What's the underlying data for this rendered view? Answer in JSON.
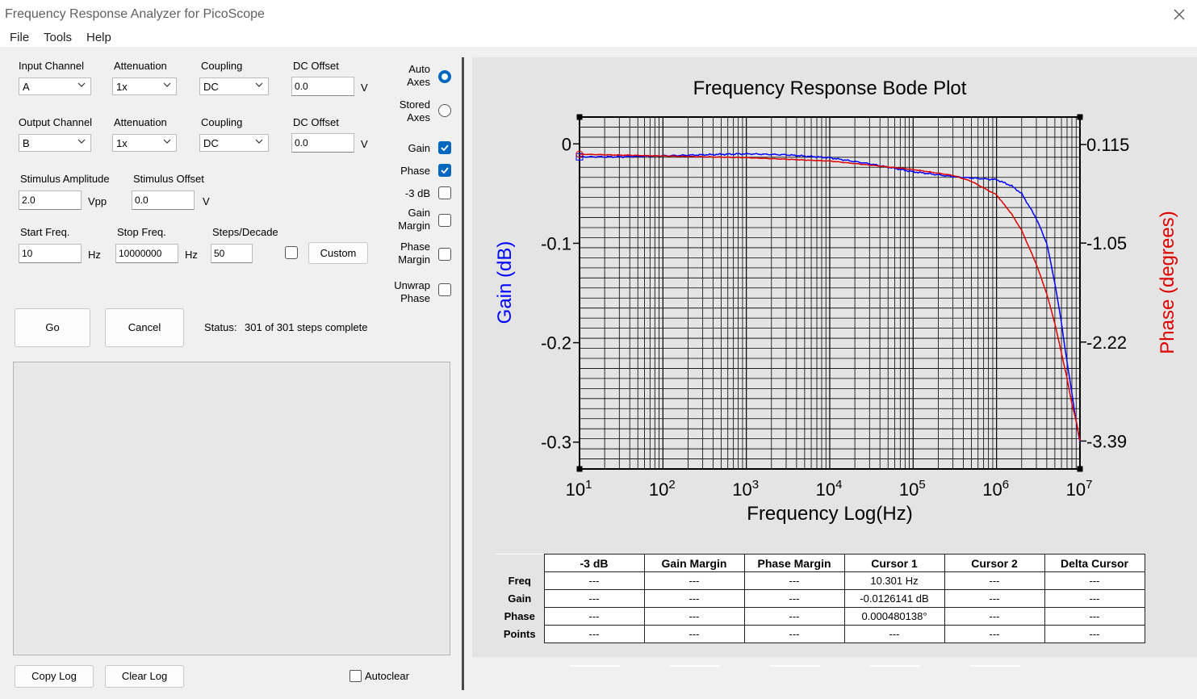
{
  "window": {
    "title": "Frequency Response Analyzer for PicoScope"
  },
  "menu": [
    "File",
    "Tools",
    "Help"
  ],
  "input_channel": {
    "label": "Input Channel",
    "value": "A"
  },
  "input_attenuation": {
    "label": "Attenuation",
    "value": "1x"
  },
  "input_coupling": {
    "label": "Coupling",
    "value": "DC"
  },
  "input_dc_offset": {
    "label": "DC Offset",
    "value": "0.0",
    "unit": "V"
  },
  "output_channel": {
    "label": "Output Channel",
    "value": "B"
  },
  "output_attenuation": {
    "label": "Attenuation",
    "value": "1x"
  },
  "output_coupling": {
    "label": "Coupling",
    "value": "DC"
  },
  "output_dc_offset": {
    "label": "DC Offset",
    "value": "0.0",
    "unit": "V"
  },
  "stimulus_amplitude": {
    "label": "Stimulus Amplitude",
    "value": "2.0",
    "unit": "Vpp"
  },
  "stimulus_offset": {
    "label": "Stimulus Offset",
    "value": "0.0",
    "unit": "V"
  },
  "start_freq": {
    "label": "Start Freq.",
    "value": "10",
    "unit": "Hz"
  },
  "stop_freq": {
    "label": "Stop Freq.",
    "value": "10000000",
    "unit": "Hz"
  },
  "steps_decade": {
    "label": "Steps/Decade",
    "value": "50"
  },
  "custom_button": "Custom",
  "go_button": "Go",
  "cancel_button": "Cancel",
  "status": {
    "label": "Status:",
    "value": "301 of 301 steps complete"
  },
  "options": {
    "auto_axes": {
      "label1": "Auto",
      "label2": "Axes",
      "selected": true
    },
    "stored_axes": {
      "label1": "Stored",
      "label2": "Axes",
      "selected": false
    },
    "gain": {
      "label": "Gain",
      "checked": true
    },
    "phase": {
      "label": "Phase",
      "checked": true
    },
    "minus3db": {
      "label": "-3 dB",
      "checked": false
    },
    "gain_margin": {
      "label1": "Gain",
      "label2": "Margin",
      "checked": false
    },
    "phase_margin": {
      "label1": "Phase",
      "label2": "Margin",
      "checked": false
    },
    "unwrap_phase": {
      "label1": "Unwrap",
      "label2": "Phase",
      "checked": false
    }
  },
  "log": {
    "copy_button": "Copy Log",
    "clear_button": "Clear Log",
    "autoclear_label": "Autoclear",
    "autoclear_checked": false
  },
  "colors": {
    "gain": "#0000ff",
    "phase": "#dd0000",
    "accent": "#0067c0"
  },
  "chart_data": {
    "type": "line",
    "title": "Frequency Response Bode Plot",
    "xlabel": "Frequency Log(Hz)",
    "ylabel": "Gain (dB)",
    "y2label": "Phase (degrees)",
    "x_scale": "log",
    "xlim": [
      10,
      10000000
    ],
    "ylim": [
      -0.327,
      0.027
    ],
    "y2lim": [
      -3.72,
      0.44
    ],
    "x_tick_base": "10",
    "x_tick_exponents": [
      "1",
      "2",
      "3",
      "4",
      "5",
      "6",
      "7"
    ],
    "y_ticks": [
      0,
      -0.1,
      -0.2,
      -0.3
    ],
    "y_tick_labels": [
      "0",
      "-0.1",
      "-0.2",
      "-0.3"
    ],
    "y2_ticks": [
      0.115,
      -1.05,
      -2.22,
      -3.39
    ],
    "y2_tick_labels": [
      "0.115",
      "-1.05",
      "-2.22",
      "-3.39"
    ],
    "grid": true,
    "series": [
      {
        "name": "Gain",
        "axis": "left",
        "x": [
          10,
          30,
          100,
          300,
          1000,
          3000,
          10000,
          30000,
          100000,
          300000,
          1000000,
          1500000,
          2000000,
          3000000,
          4000000,
          5000000,
          6000000,
          7000000,
          8000000,
          9000000,
          10000000
        ],
        "y": [
          -0.013,
          -0.013,
          -0.012,
          -0.011,
          -0.01,
          -0.011,
          -0.014,
          -0.02,
          -0.028,
          -0.033,
          -0.036,
          -0.042,
          -0.05,
          -0.075,
          -0.1,
          -0.14,
          -0.18,
          -0.22,
          -0.25,
          -0.28,
          -0.3
        ]
      },
      {
        "name": "Phase",
        "axis": "right",
        "x": [
          10,
          100,
          1000,
          10000,
          100000,
          300000,
          500000,
          1000000,
          1500000,
          2000000,
          3000000,
          4000000,
          5000000,
          6000000,
          7000000,
          8000000,
          9000000,
          10000000
        ],
        "y": [
          0.0005,
          -0.02,
          -0.04,
          -0.08,
          -0.18,
          -0.25,
          -0.32,
          -0.48,
          -0.7,
          -0.9,
          -1.3,
          -1.65,
          -2.0,
          -2.35,
          -2.65,
          -2.95,
          -3.15,
          -3.39
        ]
      }
    ]
  },
  "results_table": {
    "columns": [
      "-3 dB",
      "Gain Margin",
      "Phase Margin",
      "Cursor 1",
      "Cursor 2",
      "Delta Cursor"
    ],
    "rows": [
      {
        "label": "Freq",
        "cells": [
          "---",
          "---",
          "---",
          "10.301 Hz",
          "---",
          "---"
        ]
      },
      {
        "label": "Gain",
        "cells": [
          "---",
          "---",
          "---",
          "-0.0126141 dB",
          "---",
          "---"
        ]
      },
      {
        "label": "Phase",
        "cells": [
          "---",
          "---",
          "---",
          "0.000480138°",
          "---",
          "---"
        ]
      },
      {
        "label": "Points",
        "cells": [
          "---",
          "---",
          "---",
          "---",
          "---",
          "---"
        ]
      }
    ]
  }
}
